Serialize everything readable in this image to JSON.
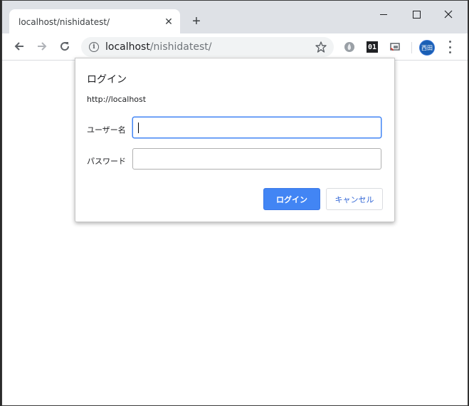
{
  "browser": {
    "tab_title": "localhost/nishidatest/",
    "url_host": "localhost",
    "url_path": "/nishidatest/",
    "avatar_text": "西田",
    "ext_2_label": "01"
  },
  "dialog": {
    "title": "ログイン",
    "origin": "http://localhost",
    "username_label": "ユーザー名",
    "username_value": "",
    "password_label": "パスワード",
    "password_value": "",
    "login_button": "ログイン",
    "cancel_button": "キャンセル"
  },
  "colors": {
    "accent": "#4285f4",
    "tabstrip": "#dee1e6",
    "omnibox": "#f1f3f4"
  }
}
